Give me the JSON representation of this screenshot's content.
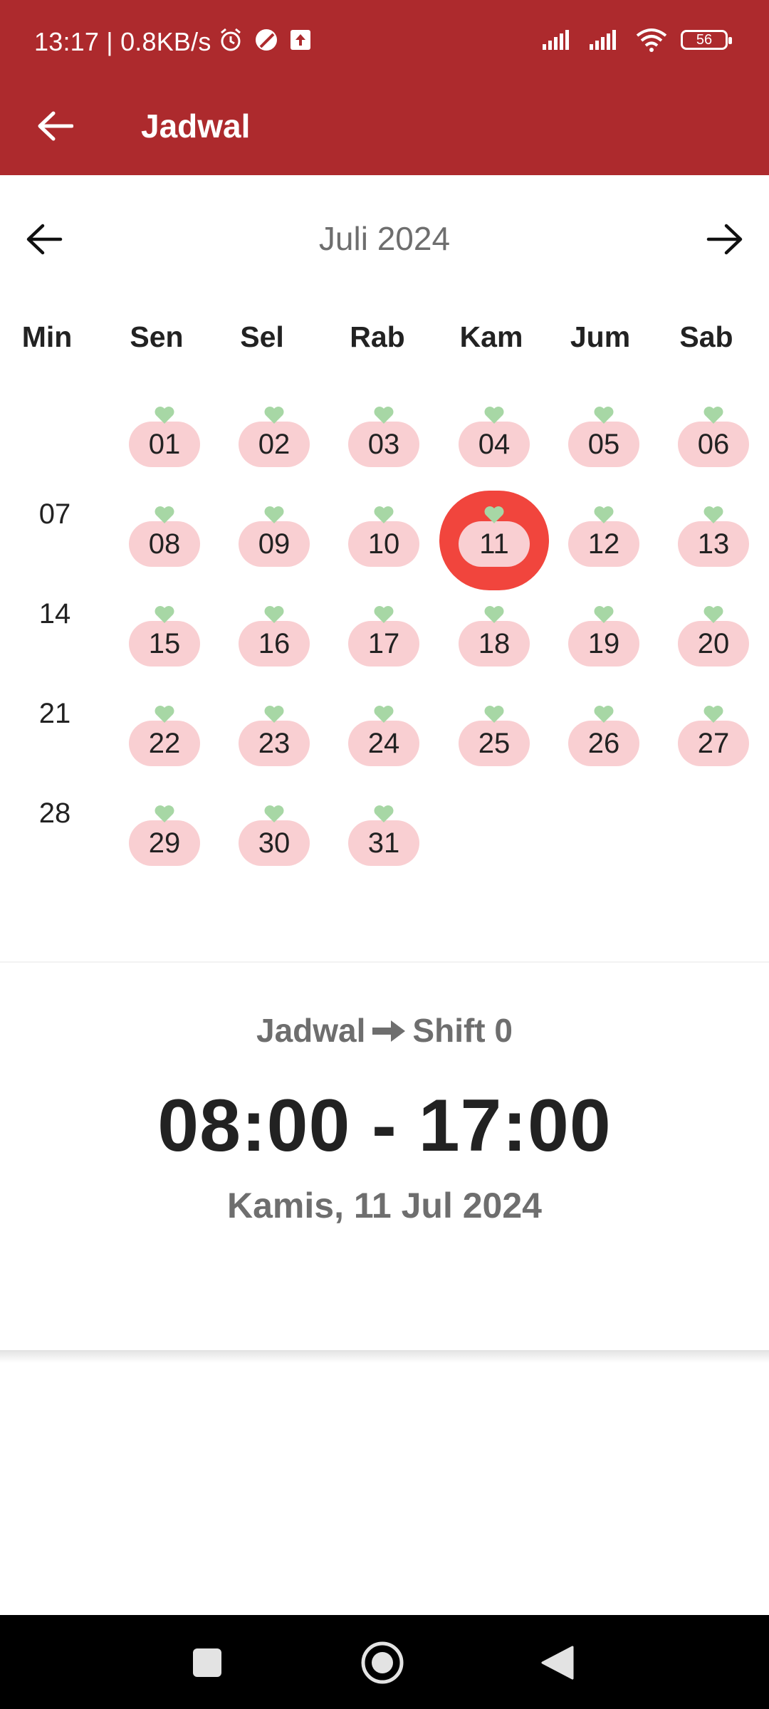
{
  "status_bar": {
    "time": "13:17",
    "speed": "0.8KB/s",
    "battery": "56",
    "icons_left": [
      "alarm-icon",
      "moon-icon",
      "upload-icon"
    ],
    "icons_right": [
      "signal-icon",
      "signal-icon",
      "wifi-icon",
      "battery-icon"
    ]
  },
  "app_bar": {
    "title": "Jadwal",
    "color": "#ad2a2d"
  },
  "calendar": {
    "month_label": "Juli 2024",
    "weekdays": [
      "Min",
      "Sen",
      "Sel",
      "Rab",
      "Kam",
      "Jum",
      "Sab"
    ],
    "weeks": [
      [
        "",
        "01",
        "02",
        "03",
        "04",
        "05",
        "06"
      ],
      [
        "07",
        "08",
        "09",
        "10",
        "11",
        "12",
        "13"
      ],
      [
        "14",
        "15",
        "16",
        "17",
        "18",
        "19",
        "20"
      ],
      [
        "21",
        "22",
        "23",
        "24",
        "25",
        "26",
        "27"
      ],
      [
        "28",
        "29",
        "30",
        "31",
        "",
        "",
        ""
      ]
    ],
    "selected_day": "11",
    "scheduled_color": "#f9cfd2",
    "selected_color": "#f1453d",
    "heart_color": "#a7d7a5"
  },
  "schedule": {
    "label": "Jadwal",
    "shift": "Shift 0",
    "time_range": "08:00 - 17:00",
    "date": "Kamis, 11 Jul 2024"
  }
}
